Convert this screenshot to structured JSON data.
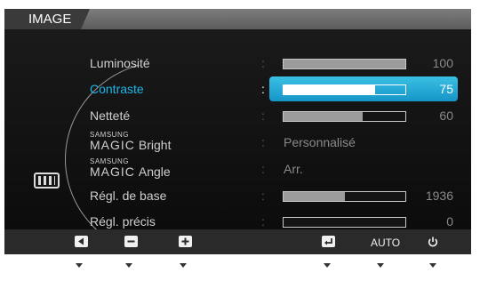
{
  "header": {
    "title": "IMAGE"
  },
  "icons": {
    "category": "picture-icon"
  },
  "menu": {
    "luminosite": {
      "label": "Luminosité",
      "colon": ":",
      "value": "100",
      "level": 1.0
    },
    "contraste": {
      "label": "Contraste",
      "colon": ":",
      "value": "75",
      "level": 0.75
    },
    "nettete": {
      "label": "Netteté",
      "colon": ":",
      "value": "60",
      "level": 0.65
    },
    "magic_bright": {
      "samsung": "SAMSUNG",
      "magic": "MAGIC",
      "suffix": "Bright",
      "colon": ":",
      "value": "Personnalisé"
    },
    "magic_angle": {
      "samsung": "SAMSUNG",
      "magic": "MAGIC",
      "suffix": "Angle",
      "colon": ":",
      "value": "Arr."
    },
    "regl_base": {
      "label": "Régl. de base",
      "colon": ":",
      "value": "1936",
      "level": 0.5
    },
    "regl_precis": {
      "label": "Régl. précis",
      "colon": ":",
      "value": "0",
      "level": 0.0
    }
  },
  "buttons": {
    "auto_label": "AUTO"
  },
  "colors": {
    "highlight": "#1fb5ea",
    "background": "#333333"
  }
}
